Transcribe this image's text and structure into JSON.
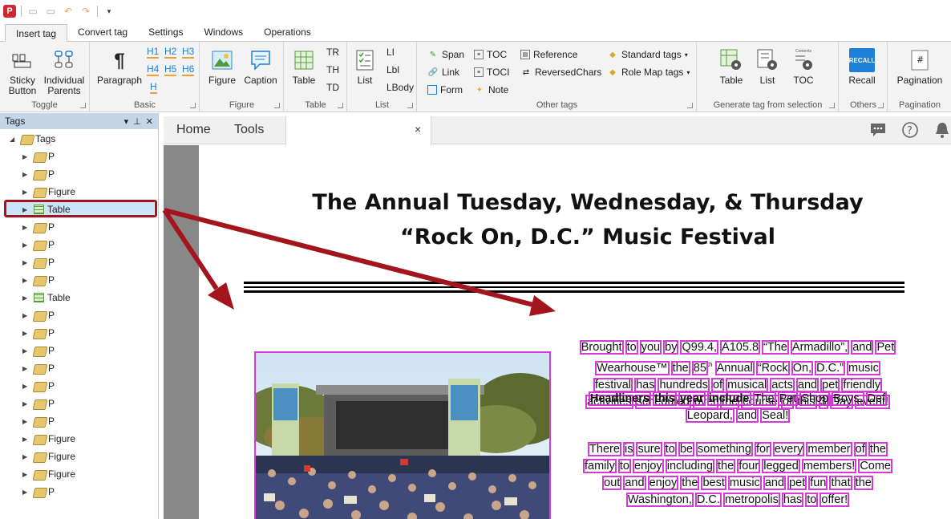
{
  "ribbon": {
    "tabs": [
      "Insert tag",
      "Convert tag",
      "Settings",
      "Windows",
      "Operations"
    ],
    "toggle": {
      "caption": "Toggle",
      "sticky_button_l1": "Sticky",
      "sticky_button_l2": "Button",
      "individual_parents_l1": "Individual",
      "individual_parents_l2": "Parents"
    },
    "basic": {
      "caption": "Basic",
      "paragraph": "Paragraph",
      "headings": [
        "H1",
        "H2",
        "H3",
        "H4",
        "H5",
        "H6",
        "H"
      ]
    },
    "figure": {
      "caption": "Figure",
      "figure": "Figure",
      "caption_btn": "Caption"
    },
    "table": {
      "caption": "Table",
      "table": "Table",
      "tr": "TR",
      "th": "TH",
      "td": "TD"
    },
    "list": {
      "caption": "List",
      "list": "List",
      "li": "LI",
      "lbl": "Lbl",
      "lbody": "LBody"
    },
    "other_tags": {
      "caption": "Other tags",
      "span": "Span",
      "link": "Link",
      "form": "Form",
      "toc": "TOC",
      "toci": "TOCI",
      "note": "Note",
      "reference": "Reference",
      "reversed_chars": "ReversedChars",
      "standard_tags": "Standard tags",
      "role_map_tags": "Role Map tags"
    },
    "generate": {
      "caption": "Generate tag from selection",
      "table": "Table",
      "list": "List",
      "toc": "TOC",
      "contents_label": "Contents"
    },
    "others": {
      "caption": "Others",
      "recall": "Recall",
      "recall_icon": "RECALL"
    },
    "pagination": {
      "caption": "Pagination",
      "pagination": "Pagination"
    }
  },
  "tags_panel": {
    "title": "Tags",
    "root": "Tags",
    "items": [
      "P",
      "P",
      "Figure",
      "Table",
      "P",
      "P",
      "P",
      "P",
      "Table",
      "P",
      "P",
      "P",
      "P",
      "P",
      "P",
      "P",
      "Figure",
      "Figure",
      "Figure",
      "P"
    ],
    "item_types": [
      "tag",
      "tag",
      "tag",
      "table",
      "tag",
      "tag",
      "tag",
      "tag",
      "table",
      "tag",
      "tag",
      "tag",
      "tag",
      "tag",
      "tag",
      "tag",
      "tag",
      "tag",
      "tag",
      "tag"
    ],
    "selected_index": 3
  },
  "doc_tabs": {
    "home": "Home",
    "tools": "Tools",
    "close": "×"
  },
  "document": {
    "title_line1": "The Annual Tuesday, Wednesday, & Thursday",
    "title_line2": "“Rock On, D.C.” Music Festival",
    "para1_lines": [
      [
        "Brought",
        "to",
        "you",
        "by",
        "Q99.4,",
        "A105.8",
        "“The",
        "Armadillo”,",
        "and",
        "Pet"
      ],
      [
        "Wearhouse™",
        "the",
        "85",
        "Annual",
        "“Rock",
        "On,",
        "D.C.”",
        "music"
      ],
      [
        "festival",
        "has",
        "hundreds",
        "of",
        "musical",
        "acts",
        "and",
        "pet",
        "friendly"
      ],
      [
        "activities",
        "scheduled",
        "over",
        "the",
        "course",
        "of",
        "this",
        "3",
        "Day",
        "event!"
      ]
    ],
    "para2_lines": [
      [
        "Headliners",
        "this",
        "year",
        "include",
        "The",
        "Pet",
        "Shop",
        "Boys,",
        "Def"
      ],
      [
        "Leopard,",
        "and",
        "Seal!"
      ]
    ],
    "para2_bold_count": 4,
    "para3_lines": [
      [
        "There",
        "is",
        "sure",
        "to",
        "be",
        "something",
        "for",
        "every",
        "member",
        "of",
        "the"
      ],
      [
        "family",
        "to",
        "enjoy",
        "including",
        "the",
        "four",
        "legged",
        "members!",
        "Come"
      ],
      [
        "out",
        "and",
        "enjoy",
        "the",
        "best",
        "music",
        "and",
        "pet",
        "fun",
        "that",
        "the"
      ],
      [
        "Washington,",
        "D.C.",
        "metropolis",
        "has",
        "to",
        "offer!"
      ]
    ],
    "superscript": "th"
  },
  "colors": {
    "highlight": "#d43ad4",
    "annotation": "#a3141d",
    "panel_header": "#c5d5e8"
  }
}
